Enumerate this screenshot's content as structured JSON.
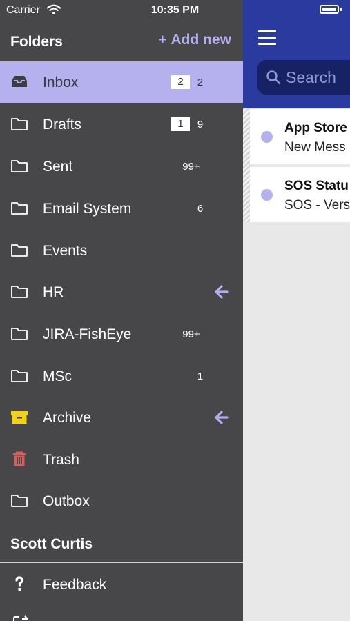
{
  "status": {
    "carrier": "Carrier",
    "time": "10:35 PM"
  },
  "header": {
    "title": "Folders",
    "add_new": "Add new"
  },
  "folders": [
    {
      "label": "Inbox",
      "icon": "inbox-icon",
      "badge": "2",
      "count": "2",
      "active": true
    },
    {
      "label": "Drafts",
      "icon": "folder-icon",
      "badge": "1",
      "count": "9"
    },
    {
      "label": "Sent",
      "icon": "folder-icon",
      "count": "99+"
    },
    {
      "label": "Email System",
      "icon": "folder-icon",
      "count": "6"
    },
    {
      "label": "Events",
      "icon": "folder-icon"
    },
    {
      "label": "HR",
      "icon": "folder-icon",
      "arrow": true
    },
    {
      "label": "JIRA-FishEye",
      "icon": "folder-icon",
      "count": "99+"
    },
    {
      "label": "MSc",
      "icon": "folder-icon",
      "count": "1"
    },
    {
      "label": "Archive",
      "icon": "archive-icon",
      "arrow": true
    },
    {
      "label": "Trash",
      "icon": "trash-icon"
    },
    {
      "label": "Outbox",
      "icon": "folder-icon"
    }
  ],
  "account": {
    "name": "Scott Curtis"
  },
  "footer": {
    "feedback_label": "Feedback"
  },
  "search": {
    "placeholder": "Search"
  },
  "messages": [
    {
      "title": "App Store",
      "subtitle": "New Mess"
    },
    {
      "title": "SOS Statu",
      "subtitle": "SOS - Vers"
    }
  ],
  "colors": {
    "menu_bg": "#474649",
    "active_row": "#b5b1ef",
    "accent": "#b1aeef",
    "header_blue": "#2a3a9e",
    "archive_yellow": "#f5d20a",
    "trash_red": "#e05a5a",
    "unread_dot": "#b3b2ec"
  }
}
